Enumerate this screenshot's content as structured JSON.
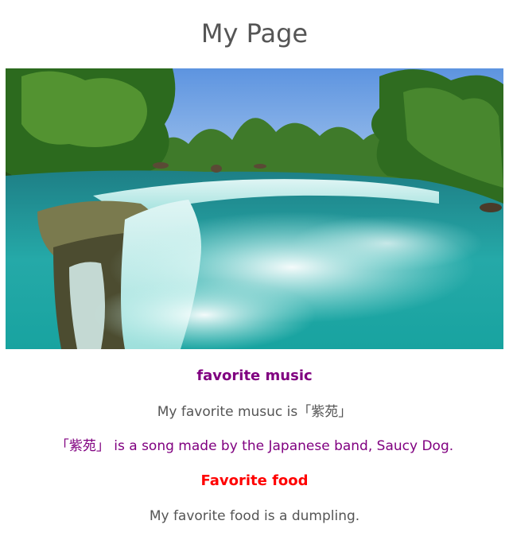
{
  "page": {
    "title": "My Page"
  },
  "hero_image": {
    "subject": "waterfall-photo",
    "alt": "Turquoise river waterfall surrounded by green trees"
  },
  "music": {
    "heading": "favorite music",
    "text": "My favorite musuc is「紫苑」",
    "description": "「紫苑」 is a song made by the Japanese band, Saucy Dog."
  },
  "food": {
    "heading": "Favorite food",
    "text": "My favorite food is a dumpling."
  },
  "colors": {
    "body_text": "#555555",
    "music_accent": "#800080",
    "food_accent": "#ff0000"
  }
}
